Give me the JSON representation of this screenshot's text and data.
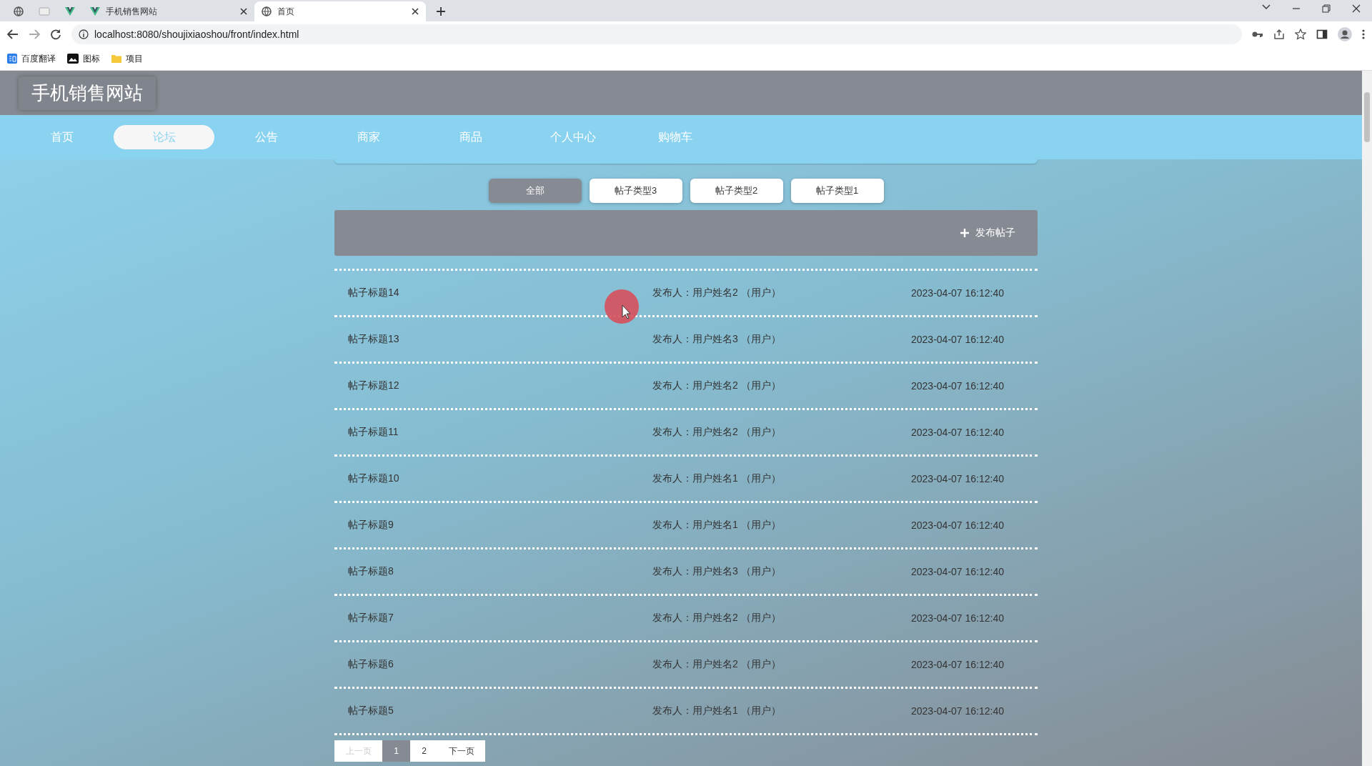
{
  "browser": {
    "tabs": [
      {
        "title": "手机销售网站",
        "selected": false
      },
      {
        "title": "首页",
        "selected": true
      }
    ],
    "address": "localhost:8080/shoujixiaoshou/front/index.html",
    "bookmarks": [
      "百度翻译",
      "图标",
      "项目"
    ]
  },
  "site": {
    "title": "手机销售网站",
    "nav": [
      {
        "label": "首页",
        "selected": false
      },
      {
        "label": "论坛",
        "selected": true
      },
      {
        "label": "公告",
        "selected": false
      },
      {
        "label": "商家",
        "selected": false
      },
      {
        "label": "商品",
        "selected": false
      },
      {
        "label": "个人中心",
        "selected": false
      },
      {
        "label": "购物车",
        "selected": false
      }
    ]
  },
  "forum": {
    "filters": [
      {
        "label": "全部",
        "selected": true
      },
      {
        "label": "帖子类型3",
        "selected": false
      },
      {
        "label": "帖子类型2",
        "selected": false
      },
      {
        "label": "帖子类型1",
        "selected": false
      }
    ],
    "post_button": "发布帖子",
    "posts": [
      {
        "title": "帖子标题14",
        "author": "发布人：用户姓名2 （用户）",
        "time": "2023-04-07 16:12:40"
      },
      {
        "title": "帖子标题13",
        "author": "发布人：用户姓名3 （用户）",
        "time": "2023-04-07 16:12:40"
      },
      {
        "title": "帖子标题12",
        "author": "发布人：用户姓名2 （用户）",
        "time": "2023-04-07 16:12:40"
      },
      {
        "title": "帖子标题11",
        "author": "发布人：用户姓名2 （用户）",
        "time": "2023-04-07 16:12:40"
      },
      {
        "title": "帖子标题10",
        "author": "发布人：用户姓名1 （用户）",
        "time": "2023-04-07 16:12:40"
      },
      {
        "title": "帖子标题9",
        "author": "发布人：用户姓名1 （用户）",
        "time": "2023-04-07 16:12:40"
      },
      {
        "title": "帖子标题8",
        "author": "发布人：用户姓名3 （用户）",
        "time": "2023-04-07 16:12:40"
      },
      {
        "title": "帖子标题7",
        "author": "发布人：用户姓名2 （用户）",
        "time": "2023-04-07 16:12:40"
      },
      {
        "title": "帖子标题6",
        "author": "发布人：用户姓名2 （用户）",
        "time": "2023-04-07 16:12:40"
      },
      {
        "title": "帖子标题5",
        "author": "发布人：用户姓名1 （用户）",
        "time": "2023-04-07 16:12:40"
      }
    ],
    "pagination": {
      "prev": {
        "label": "上一页",
        "disabled": true
      },
      "pages": [
        {
          "label": "1",
          "selected": true
        },
        {
          "label": "2",
          "selected": false
        }
      ],
      "next": {
        "label": "下一页",
        "disabled": false
      }
    }
  }
}
